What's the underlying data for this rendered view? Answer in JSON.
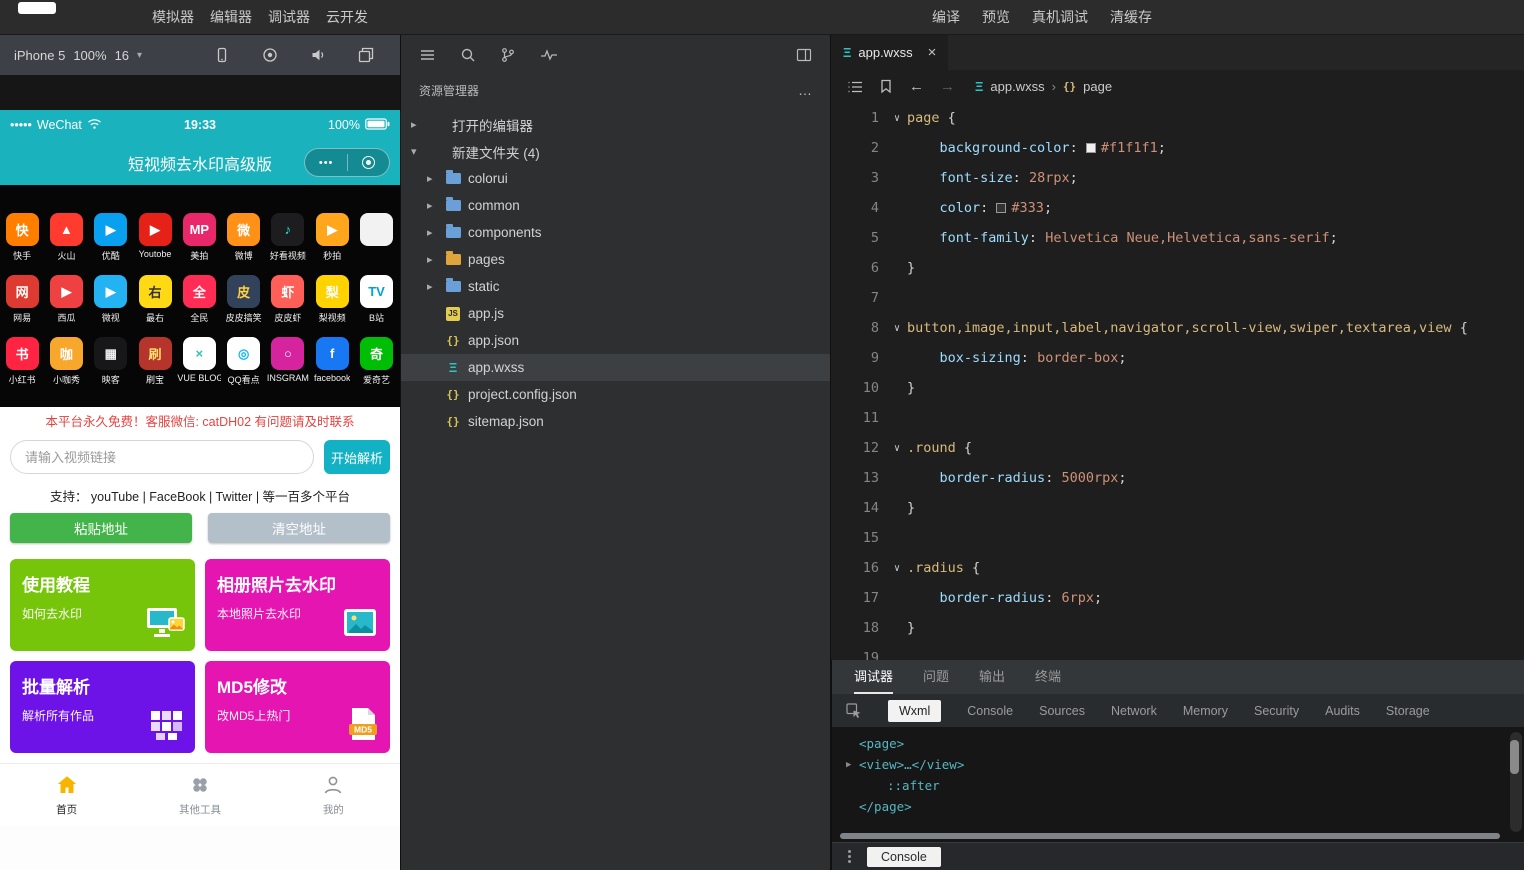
{
  "topbar": {
    "left_menu": [
      {
        "label": "模拟器",
        "name": "simulator"
      },
      {
        "label": "编辑器",
        "name": "editor"
      },
      {
        "label": "调试器",
        "name": "debugger"
      },
      {
        "label": "云开发",
        "name": "cloud-dev"
      }
    ],
    "right_menu": [
      {
        "label": "编译",
        "name": "compile"
      },
      {
        "label": "预览",
        "name": "preview"
      },
      {
        "label": "真机调试",
        "name": "real-device-debug"
      },
      {
        "label": "清缓存",
        "name": "clear-cache"
      }
    ]
  },
  "simulator": {
    "toolbar": {
      "device": "iPhone 5",
      "zoom": "100%",
      "extra": "16"
    },
    "status_bar": {
      "carrier_dots": "•••••",
      "carrier": "WeChat",
      "time": "19:33",
      "battery": "100%"
    },
    "nav": {
      "title": "短视频去水印高级版",
      "capsule_more": "•••"
    },
    "platforms": [
      {
        "label": "快手",
        "glyph": "快",
        "bg": "#ff7e00",
        "fg": "#ffffff"
      },
      {
        "label": "火山",
        "glyph": "▲",
        "bg": "#ff3b30",
        "fg": "#ffffff"
      },
      {
        "label": "优酷",
        "glyph": "▶",
        "bg": "#0aa0f0",
        "fg": "#ffffff"
      },
      {
        "label": "Youtobe",
        "glyph": "▶",
        "bg": "#e62117",
        "fg": "#ffffff"
      },
      {
        "label": "美拍",
        "glyph": "MP",
        "bg": "#e8286b",
        "fg": "#ffffff"
      },
      {
        "label": "微博",
        "glyph": "微",
        "bg": "#ff9018",
        "fg": "#ffffff"
      },
      {
        "label": "好看视频",
        "glyph": "♪",
        "bg": "#1d1d1f",
        "fg": "#25e6e0"
      },
      {
        "label": "秒拍",
        "glyph": "▶",
        "bg": "#ffa61c",
        "fg": "#ffffff"
      },
      {
        "label": "",
        "glyph": "",
        "bg": "#f2f2f2",
        "fg": "#999999"
      },
      {
        "label": "网易",
        "glyph": "网",
        "bg": "#dd3a31",
        "fg": "#ffffff"
      },
      {
        "label": "西瓜",
        "glyph": "▶",
        "bg": "#f04142",
        "fg": "#ffffff"
      },
      {
        "label": "微视",
        "glyph": "▶",
        "bg": "#23b2f2",
        "fg": "#ffffff"
      },
      {
        "label": "最右",
        "glyph": "右",
        "bg": "#ffd913",
        "fg": "#333333"
      },
      {
        "label": "全民",
        "glyph": "全",
        "bg": "#ff2c55",
        "fg": "#ffffff"
      },
      {
        "label": "皮皮搞笑",
        "glyph": "皮",
        "bg": "#33425b",
        "fg": "#ffd23e"
      },
      {
        "label": "皮皮虾",
        "glyph": "虾",
        "bg": "#ff5f57",
        "fg": "#ffffff"
      },
      {
        "label": "梨视频",
        "glyph": "梨",
        "bg": "#ffd200",
        "fg": "#ffffff"
      },
      {
        "label": "B站",
        "glyph": "TV",
        "bg": "#ffffff",
        "fg": "#00a1d6"
      },
      {
        "label": "小红书",
        "glyph": "书",
        "bg": "#ff2442",
        "fg": "#ffffff"
      },
      {
        "label": "小咖秀",
        "glyph": "咖",
        "bg": "#f7a82c",
        "fg": "#ffffff"
      },
      {
        "label": "映客",
        "glyph": "▦",
        "bg": "#17171a",
        "fg": "#eeeeee"
      },
      {
        "label": "刷宝",
        "glyph": "刷",
        "bg": "#b5342c",
        "fg": "#ffe06e"
      },
      {
        "label": "VUE BLOG",
        "glyph": "×",
        "bg": "#ffffff",
        "fg": "#35c3b0"
      },
      {
        "label": "QQ看点",
        "glyph": "◎",
        "bg": "#ffffff",
        "fg": "#12b7f5"
      },
      {
        "label": "INSGRAM",
        "glyph": "○",
        "bg": "#d6249f",
        "fg": "#ffffff"
      },
      {
        "label": "facebook",
        "glyph": "f",
        "bg": "#1877f2",
        "fg": "#ffffff"
      },
      {
        "label": "爱奇艺",
        "glyph": "奇",
        "bg": "#00be06",
        "fg": "#ffffff"
      }
    ],
    "notice": "本平台永久免费！客服微信: catDH02 有问题请及时联系",
    "input": {
      "placeholder": "请输入视频链接",
      "button": "开始解析"
    },
    "support": "支持： youTube | FaceBook | Twitter | 等一百多个平台",
    "paste_button": "粘贴地址",
    "clear_button": "清空地址",
    "cards": [
      {
        "name": "tutorial",
        "title": "使用教程",
        "subtitle": "如何去水印",
        "bg": "#76c50b",
        "icon": "tutorial-monitor-icon"
      },
      {
        "name": "album-watermark",
        "title": "相册照片去水印",
        "subtitle": "本地照片去水印",
        "bg": "#e515b2",
        "icon": "album-photo-icon"
      },
      {
        "name": "batch-parse",
        "title": "批量解析",
        "subtitle": "解析所有作品",
        "bg": "#6e13e8",
        "icon": "batch-grid-icon"
      },
      {
        "name": "md5-modify",
        "title": "MD5修改",
        "subtitle": "改MD5上热门",
        "bg": "#e515b2",
        "icon": "md5-file-icon"
      }
    ],
    "tabbar": [
      {
        "label": "首页",
        "name": "home",
        "icon": "home-icon",
        "active": true
      },
      {
        "label": "其他工具",
        "name": "tools",
        "icon": "tools-icon",
        "active": false
      },
      {
        "label": "我的",
        "name": "profile",
        "icon": "profile-icon",
        "active": false
      }
    ]
  },
  "explorer": {
    "title": "资源管理器",
    "more": "…",
    "tree": [
      {
        "label": "打开的编辑器",
        "name": "open-editors",
        "arrow": "▸",
        "icon": "none",
        "indent": 0
      },
      {
        "label": "新建文件夹 (4)",
        "name": "new-folder",
        "arrow": "▾",
        "icon": "none",
        "indent": 0
      },
      {
        "label": "colorui",
        "name": "colorui",
        "arrow": "▸",
        "icon": "folder",
        "color": "#6a9fd8",
        "indent": 1
      },
      {
        "label": "common",
        "name": "common",
        "arrow": "▸",
        "icon": "folder",
        "color": "#6a9fd8",
        "indent": 1
      },
      {
        "label": "components",
        "name": "components",
        "arrow": "▸",
        "icon": "folder",
        "color": "#6a9fd8",
        "indent": 1
      },
      {
        "label": "pages",
        "name": "pages",
        "arrow": "▸",
        "icon": "folder",
        "color": "#e0a43c",
        "indent": 1
      },
      {
        "label": "static",
        "name": "static",
        "arrow": "▸",
        "icon": "folder",
        "color": "#6a9fd8",
        "indent": 1
      },
      {
        "label": "app.js",
        "name": "app-js",
        "icon": "js",
        "indent": 1
      },
      {
        "label": "app.json",
        "name": "app-json",
        "icon": "json",
        "indent": 1
      },
      {
        "label": "app.wxss",
        "name": "app-wxss",
        "icon": "wxss",
        "indent": 1,
        "selected": true
      },
      {
        "label": "project.config.json",
        "name": "project-config-json",
        "icon": "json",
        "indent": 1
      },
      {
        "label": "sitemap.json",
        "name": "sitemap-json",
        "icon": "json",
        "indent": 1
      }
    ]
  },
  "editor": {
    "tab_label": "app.wxss",
    "breadcrumb": [
      {
        "label": "app.wxss",
        "icon": "wxss-icon"
      },
      {
        "label": "page",
        "icon": "symbol-icon"
      }
    ],
    "lines": [
      {
        "n": "1",
        "fold": true,
        "tokens": [
          {
            "t": "page",
            "c": "sel"
          },
          {
            "t": " {",
            "c": "pun"
          }
        ]
      },
      {
        "n": "2",
        "tokens": [
          {
            "t": "    ",
            "c": "pun"
          },
          {
            "t": "background-color",
            "c": "prop"
          },
          {
            "t": ": ",
            "c": "pun"
          },
          {
            "t": "#f1f1f1",
            "c": "val",
            "swatch": "#f1f1f1"
          },
          {
            "t": ";",
            "c": "pun"
          }
        ]
      },
      {
        "n": "3",
        "tokens": [
          {
            "t": "    ",
            "c": "pun"
          },
          {
            "t": "font-size",
            "c": "prop"
          },
          {
            "t": ": ",
            "c": "pun"
          },
          {
            "t": "28rpx",
            "c": "val"
          },
          {
            "t": ";",
            "c": "pun"
          }
        ]
      },
      {
        "n": "4",
        "tokens": [
          {
            "t": "    ",
            "c": "pun"
          },
          {
            "t": "color",
            "c": "prop"
          },
          {
            "t": ": ",
            "c": "pun"
          },
          {
            "t": "#333",
            "c": "val",
            "swatch": "#333333"
          },
          {
            "t": ";",
            "c": "pun"
          }
        ]
      },
      {
        "n": "5",
        "tokens": [
          {
            "t": "    ",
            "c": "pun"
          },
          {
            "t": "font-family",
            "c": "prop"
          },
          {
            "t": ": ",
            "c": "pun"
          },
          {
            "t": "Helvetica Neue,Helvetica,sans-serif",
            "c": "val"
          },
          {
            "t": ";",
            "c": "pun"
          }
        ]
      },
      {
        "n": "6",
        "tokens": [
          {
            "t": "}",
            "c": "pun"
          }
        ]
      },
      {
        "n": "7",
        "tokens": []
      },
      {
        "n": "8",
        "fold": true,
        "tokens": [
          {
            "t": "button,image,input,label,navigator,scroll-view,swiper,textarea,view",
            "c": "sel"
          },
          {
            "t": " {",
            "c": "pun"
          }
        ]
      },
      {
        "n": "9",
        "tokens": [
          {
            "t": "    ",
            "c": "pun"
          },
          {
            "t": "box-sizing",
            "c": "prop"
          },
          {
            "t": ": ",
            "c": "pun"
          },
          {
            "t": "border-box",
            "c": "val"
          },
          {
            "t": ";",
            "c": "pun"
          }
        ]
      },
      {
        "n": "10",
        "tokens": [
          {
            "t": "}",
            "c": "pun"
          }
        ]
      },
      {
        "n": "11",
        "tokens": []
      },
      {
        "n": "12",
        "fold": true,
        "tokens": [
          {
            "t": ".round",
            "c": "sel"
          },
          {
            "t": " {",
            "c": "pun"
          }
        ]
      },
      {
        "n": "13",
        "tokens": [
          {
            "t": "    ",
            "c": "pun"
          },
          {
            "t": "border-radius",
            "c": "prop"
          },
          {
            "t": ": ",
            "c": "pun"
          },
          {
            "t": "5000rpx",
            "c": "val"
          },
          {
            "t": ";",
            "c": "pun"
          }
        ]
      },
      {
        "n": "14",
        "tokens": [
          {
            "t": "}",
            "c": "pun"
          }
        ]
      },
      {
        "n": "15",
        "tokens": []
      },
      {
        "n": "16",
        "fold": true,
        "tokens": [
          {
            "t": ".radius",
            "c": "sel"
          },
          {
            "t": " {",
            "c": "pun"
          }
        ]
      },
      {
        "n": "17",
        "tokens": [
          {
            "t": "    ",
            "c": "pun"
          },
          {
            "t": "border-radius",
            "c": "prop"
          },
          {
            "t": ": ",
            "c": "pun"
          },
          {
            "t": "6rpx",
            "c": "val"
          },
          {
            "t": ";",
            "c": "pun"
          }
        ]
      },
      {
        "n": "18",
        "tokens": [
          {
            "t": "}",
            "c": "pun"
          }
        ]
      },
      {
        "n": "19",
        "tokens": []
      }
    ]
  },
  "debugger": {
    "panel_tabs": [
      {
        "label": "调试器",
        "name": "debugger",
        "active": true
      },
      {
        "label": "问题",
        "name": "issues",
        "active": false
      },
      {
        "label": "输出",
        "name": "output",
        "active": false
      },
      {
        "label": "终端",
        "name": "terminal",
        "active": false
      }
    ],
    "devtools_tabs": [
      {
        "label": "Wxml",
        "name": "wxml",
        "active": true
      },
      {
        "label": "Console",
        "name": "console",
        "active": false
      },
      {
        "label": "Sources",
        "name": "sources",
        "active": false
      },
      {
        "label": "Network",
        "name": "network",
        "active": false
      },
      {
        "label": "Memory",
        "name": "memory",
        "active": false
      },
      {
        "label": "Security",
        "name": "security",
        "active": false
      },
      {
        "label": "Audits",
        "name": "audits",
        "active": false
      },
      {
        "label": "Storage",
        "name": "storage",
        "active": false
      }
    ],
    "wxml_tree": [
      {
        "text": "<page>",
        "arrow": "",
        "indent": 0
      },
      {
        "text": "<view>…</view>",
        "arrow": "▶",
        "indent": 0
      },
      {
        "text": "::after",
        "arrow": "",
        "indent": 1
      },
      {
        "text": "</page>",
        "arrow": "",
        "indent": 0
      }
    ],
    "drawer_tab": "Console"
  }
}
